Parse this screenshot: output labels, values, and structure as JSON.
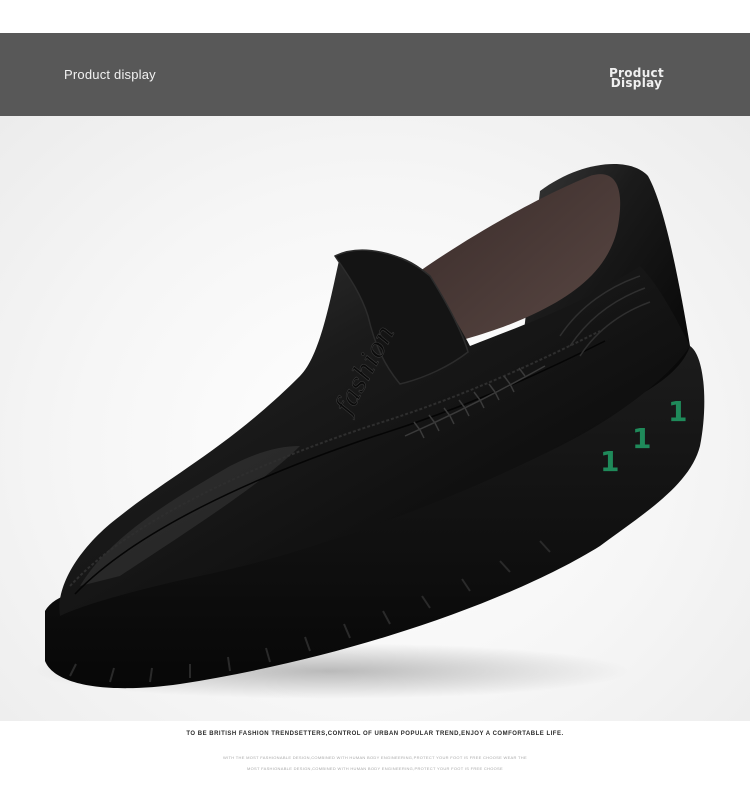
{
  "banner": {
    "left_label": "Product display",
    "right_label_line1": "Product",
    "right_label_line2": "Display"
  },
  "product": {
    "emboss_text": "fashion",
    "sole_marks": [
      "1",
      "1",
      "1"
    ],
    "sole_mark_color": "#1f8a5a"
  },
  "caption": {
    "main": "TO BE BRITISH FASHION TRENDSETTERS,CONTROL OF URBAN POPULAR TREND,ENJOY A COMFORTABLE LIFE.",
    "sub_line1": "WITH THE MOST FASHIONABLE DESIGN,COMBINED WITH HUMAN BODY ENGINEERING,PROTECT YOUR FOOT IS FREE CHOOSE WEAR THE",
    "sub_line2": "MOST FASHIONABLE DESIGN,COMBINED WITH HUMAN BODY ENGINEERING,PROTECT YOUR FOOT IS FREE CHOOSE"
  }
}
